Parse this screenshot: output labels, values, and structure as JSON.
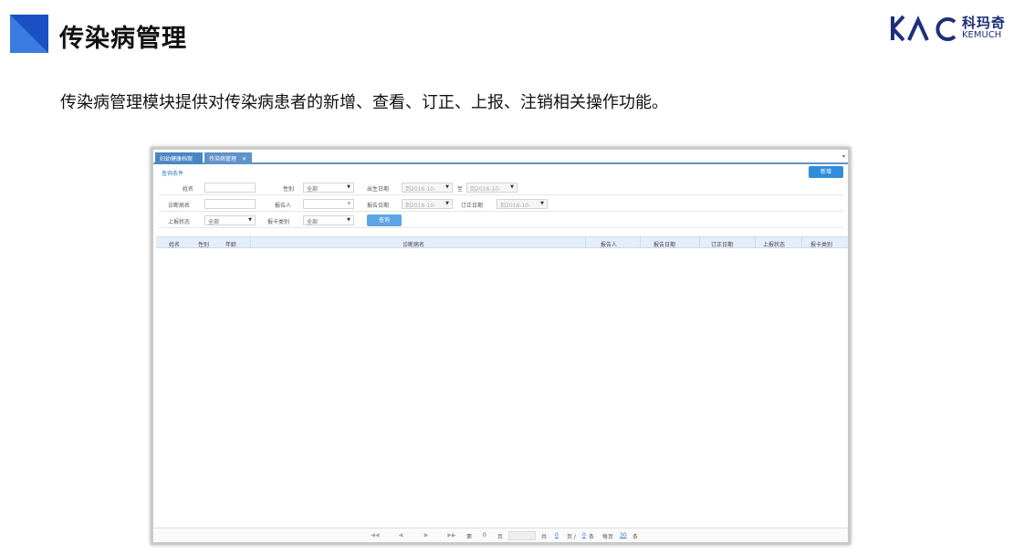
{
  "slide": {
    "title": "传染病管理",
    "description": "传染病管理模块提供对传染病患者的新增、查看、订正、上报、注销相关操作功能。",
    "logo_cn": "科玛奇",
    "logo_en": "KEMUCH",
    "accent_color": "#1b4fc4"
  },
  "app": {
    "tabs": [
      {
        "label": "妇幼健康档案"
      },
      {
        "label": "传染病管理",
        "close": "✕"
      }
    ],
    "query_section_label": "查询条件",
    "new_button": "新增",
    "query": {
      "name_label": "姓名",
      "name_value": "",
      "gender_label": "性别",
      "gender_value": "全部",
      "birth_label": "出生日期",
      "birth_from": "到2016-10-",
      "to_label": "至",
      "birth_to": "到2016-10-",
      "diagnosis_label": "诊断病名",
      "diagnosis_value": "",
      "reporter_label": "报告人",
      "reporter_value": "",
      "report_date_label": "报告日期",
      "report_date_value": "到2016-10-",
      "correction_date_label": "订正日期",
      "correction_date_value": "到2016-10-",
      "report_status_label": "上报状态",
      "report_status_value": "全部",
      "card_type_label": "报卡类别",
      "card_type_value": "全部",
      "query_button": "查询"
    },
    "columns": [
      "姓名",
      "性别",
      "年龄",
      "诊断病名",
      "报告人",
      "报告日期",
      "订正日期",
      "上报状态",
      "报卡类别"
    ],
    "rows": [],
    "pager": {
      "first": "◀◀",
      "prev": "◀",
      "next": "▶",
      "last": "▶▶",
      "page_prefix": "第",
      "page_value": "0",
      "page_suffix": "页",
      "total_prefix": "共",
      "total_pages": "0",
      "total_mid": "页 /",
      "total_records": "0",
      "records_suffix": "条",
      "per_page_prefix": "每页",
      "per_page": "30",
      "per_page_suffix": "条"
    }
  }
}
